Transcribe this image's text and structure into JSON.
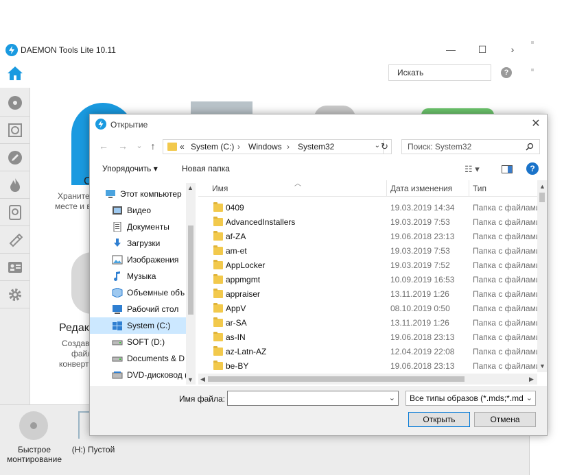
{
  "app": {
    "title": "DAEMON Tools Lite 10.11",
    "search_placeholder": "Искать",
    "help_label": "?",
    "win_minimize": "—",
    "win_maximize": "☐",
    "win_forward": "›",
    "text_fragments": {
      "c_letter": "C",
      "store_line1": "Храните",
      "store_line2": "месте и в",
      "edit_title": "Редакт",
      "edit_line1": "Создава",
      "edit_line2": "файл",
      "edit_line3": "конверт"
    },
    "bottom": {
      "quick_mount_line1": "Быстрое",
      "quick_mount_line2": "монтирование",
      "drive_label": "(H:) Пустой"
    },
    "sidebar_icons": [
      "disc-icon",
      "image-icon",
      "pencil-icon",
      "flame-icon",
      "virtual-hdd-icon",
      "usb-icon",
      "contacts-icon",
      "gear-icon"
    ],
    "accent_color": "#1a9ae0"
  },
  "dialog": {
    "title": "Открытие",
    "close": "✕",
    "nav": {
      "back": "←",
      "forward": "→",
      "recent": "⌄",
      "up": "↑"
    },
    "address": {
      "prefix": "«",
      "parts": [
        "System (C:)",
        "Windows",
        "System32"
      ],
      "separator": "›",
      "dropdown": "⌄"
    },
    "refresh": "↻",
    "search_placeholder": "Поиск: System32",
    "toolbar": {
      "organize": "Упорядочить ▾",
      "new_folder": "Новая папка",
      "view_icon": "☷ ▾",
      "pane_icon": "▯",
      "help": "?"
    },
    "tree": [
      {
        "label": "Этот компьютер",
        "icon": "computer-icon"
      },
      {
        "label": "Видео",
        "icon": "video-icon"
      },
      {
        "label": "Документы",
        "icon": "documents-icon"
      },
      {
        "label": "Загрузки",
        "icon": "downloads-icon"
      },
      {
        "label": "Изображения",
        "icon": "pictures-icon"
      },
      {
        "label": "Музыка",
        "icon": "music-icon"
      },
      {
        "label": "Объемные объ",
        "icon": "3d-objects-icon"
      },
      {
        "label": "Рабочий стол",
        "icon": "desktop-icon"
      },
      {
        "label": "System (C:)",
        "icon": "windows-drive-icon",
        "selected": true
      },
      {
        "label": "SOFT (D:)",
        "icon": "drive-icon"
      },
      {
        "label": "Documents & D",
        "icon": "drive-icon"
      },
      {
        "label": "DVD-дисковод (",
        "icon": "dvd-icon"
      }
    ],
    "columns": {
      "name": "Имя",
      "date": "Дата изменения",
      "type": "Тип"
    },
    "files": [
      {
        "name": "0409",
        "date": "19.03.2019 14:34",
        "type": "Папка с файлами"
      },
      {
        "name": "AdvancedInstallers",
        "date": "19.03.2019 7:53",
        "type": "Папка с файлами"
      },
      {
        "name": "af-ZA",
        "date": "19.06.2018 23:13",
        "type": "Папка с файлами"
      },
      {
        "name": "am-et",
        "date": "19.03.2019 7:53",
        "type": "Папка с файлами"
      },
      {
        "name": "AppLocker",
        "date": "19.03.2019 7:52",
        "type": "Папка с файлами"
      },
      {
        "name": "appmgmt",
        "date": "10.09.2019 16:53",
        "type": "Папка с файлами"
      },
      {
        "name": "appraiser",
        "date": "13.11.2019 1:26",
        "type": "Папка с файлами"
      },
      {
        "name": "AppV",
        "date": "08.10.2019 0:50",
        "type": "Папка с файлами"
      },
      {
        "name": "ar-SA",
        "date": "13.11.2019 1:26",
        "type": "Папка с файлами"
      },
      {
        "name": "as-IN",
        "date": "19.06.2018 23:13",
        "type": "Папка с файлами"
      },
      {
        "name": "az-Latn-AZ",
        "date": "12.04.2019 22:08",
        "type": "Папка с файлами"
      },
      {
        "name": "be-BY",
        "date": "19.06.2018 23:13",
        "type": "Папка с файлами"
      }
    ],
    "filename_label": "Имя файла:",
    "filename_value": "",
    "filetype_value": "Все типы образов (*.mds;*.md",
    "open_button": "Открыть",
    "cancel_button": "Отмена",
    "folder_color": "#f2c94c",
    "selection_color": "#cce8ff"
  }
}
